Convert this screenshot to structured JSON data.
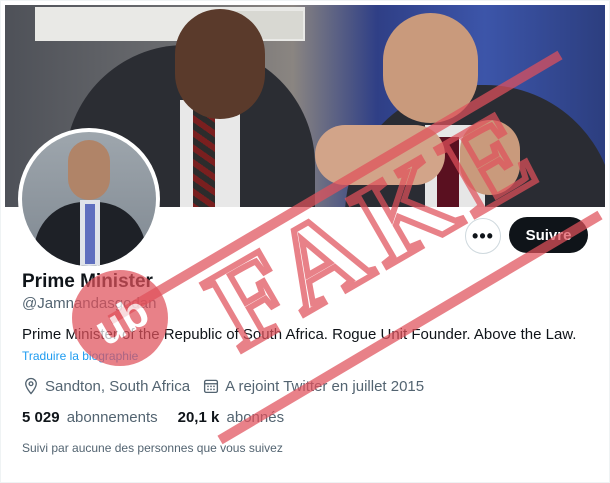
{
  "profile": {
    "name": "Prime Minister",
    "handle": "@Jamnandasgodan",
    "bio": "Prime Minister of the Republic of South Africa. Rogue Unit Founder. Above the Law.",
    "translate_label": "Traduire la biographie",
    "location": "Sandton, South Africa",
    "joined": "A rejoint Twitter en juillet 2015",
    "following_count": "5 029",
    "following_label": "abonnements",
    "followers_count": "20,1 k",
    "followers_label": "abonnés",
    "followed_by": "Suivi par aucune des personnes que vous suivez"
  },
  "actions": {
    "more_label": "•••",
    "follow_label": "Suivre"
  },
  "stamp": {
    "text": "FAKE",
    "logo_text": "ub",
    "color": "#e0515b"
  },
  "icons": [
    "location-icon",
    "calendar-icon",
    "more-icon"
  ],
  "colors": {
    "accent": "#1d9bf0",
    "text": "#0f1419",
    "secondary": "#536471",
    "follow_button_bg": "#0f1419"
  }
}
